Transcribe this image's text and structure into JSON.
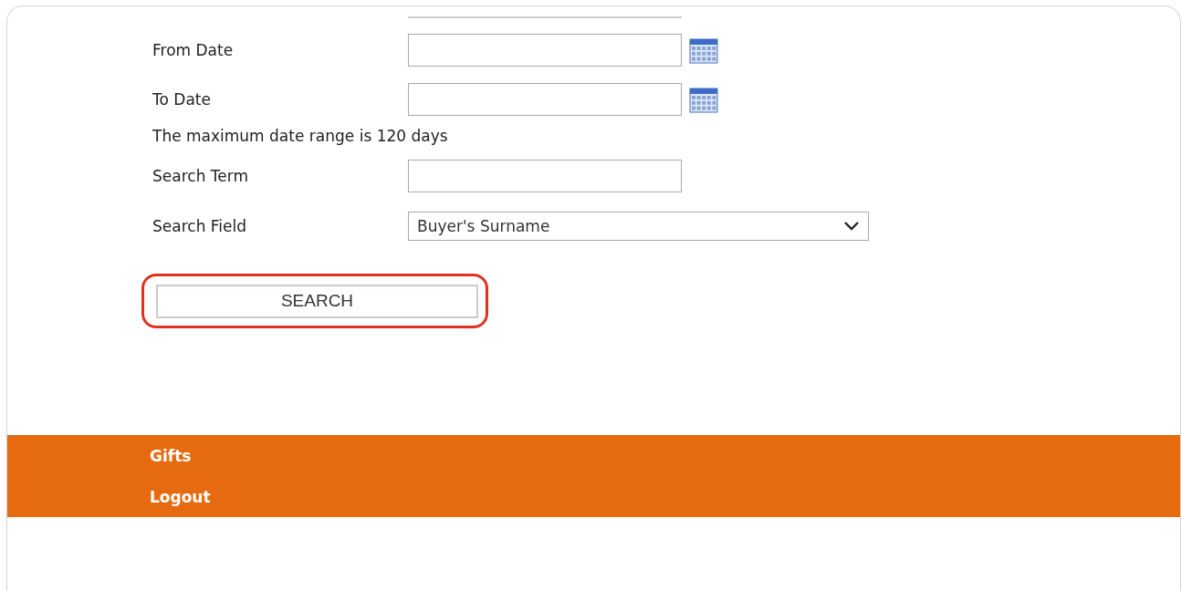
{
  "fields": [
    {
      "label": "From Date",
      "kind": "date"
    },
    {
      "label": "To Date",
      "kind": "date"
    },
    {
      "kind": "note",
      "label": "The maximum date range is 120 days"
    },
    {
      "label": "Search Term",
      "kind": "text"
    },
    {
      "label": "Search Field",
      "kind": "select",
      "value": "Buyer's Surname"
    }
  ],
  "search_button": {
    "label": "SEARCH",
    "highlighted": true
  },
  "footer_menu": [
    {
      "label": "Gifts"
    },
    {
      "label": "Logout"
    }
  ]
}
